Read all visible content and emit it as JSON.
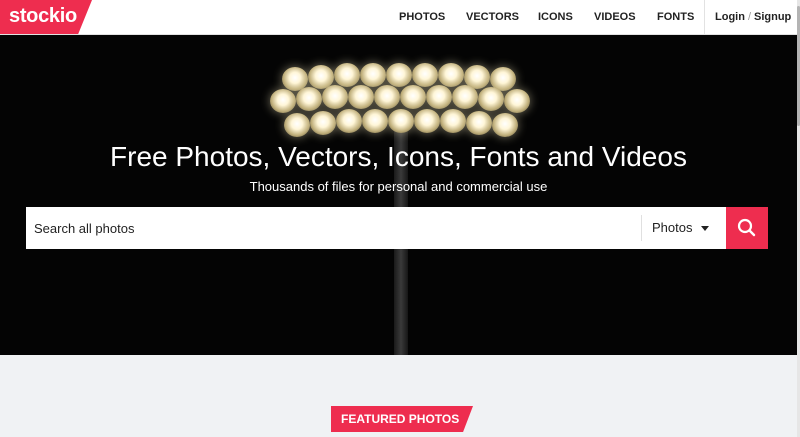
{
  "brand": {
    "logo_text": "stockio",
    "accent": "#ee2d4f"
  },
  "nav": {
    "items": [
      "PHOTOS",
      "VECTORS",
      "ICONS",
      "VIDEOS",
      "FONTS"
    ],
    "login_label": "Login",
    "separator": "/",
    "signup_label": "Signup"
  },
  "hero": {
    "title": "Free Photos, Vectors, Icons, Fonts and Videos",
    "subtitle": "Thousands of files for personal and commercial use"
  },
  "search": {
    "placeholder": "Search all photos",
    "type_selected": "Photos",
    "button_icon": "search-icon"
  },
  "featured": {
    "label": "FEATURED PHOTOS"
  }
}
